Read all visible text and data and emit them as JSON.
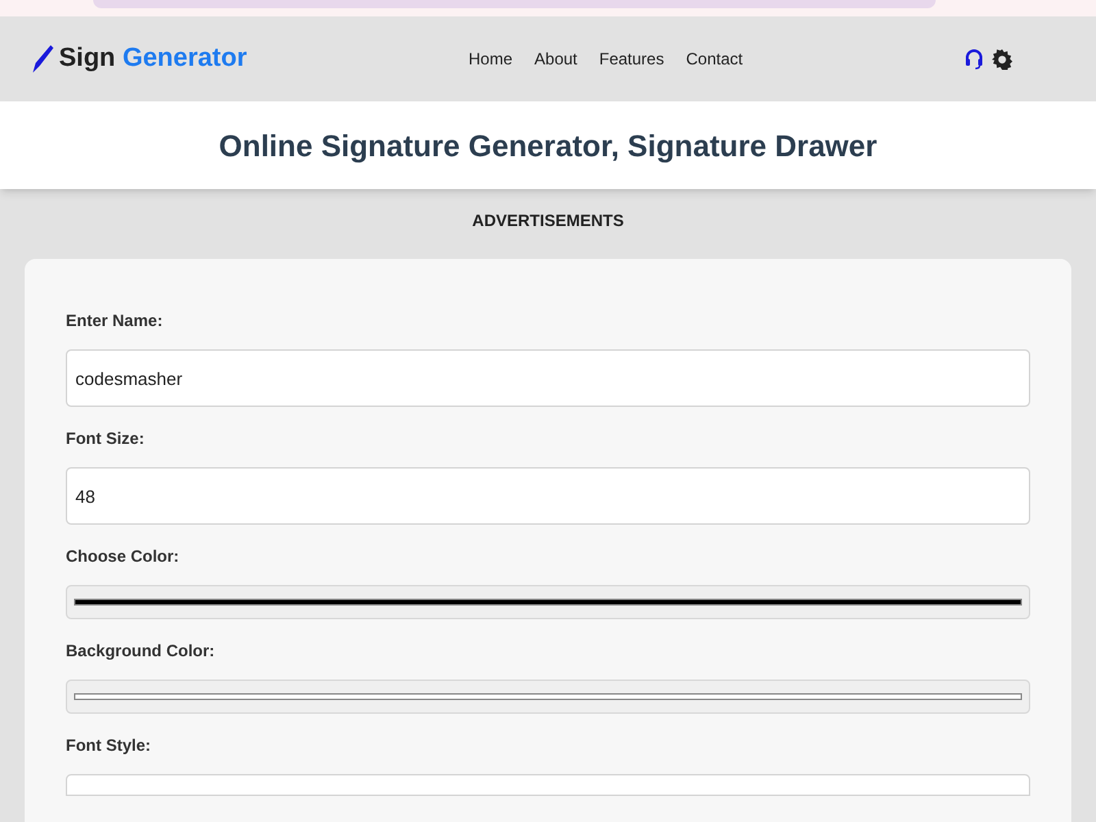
{
  "brand": {
    "part_1": "Sign",
    "part_2": "Generator"
  },
  "nav": [
    "Home",
    "About",
    "Features",
    "Contact"
  ],
  "title": "Online Signature Generator, Signature Drawer",
  "ad_label": "ADVERTISEMENTS",
  "fields": [
    {
      "kind": "text",
      "label": "Enter Name:",
      "value": "codesmasher"
    },
    {
      "kind": "text",
      "label": "Font Size:",
      "value": "48"
    },
    {
      "kind": "color",
      "label": "Choose Color:",
      "color": "#000000"
    },
    {
      "kind": "color",
      "label": "Background Color:",
      "color": "#ffffff"
    },
    {
      "kind": "select",
      "label": "Font Style:"
    }
  ]
}
